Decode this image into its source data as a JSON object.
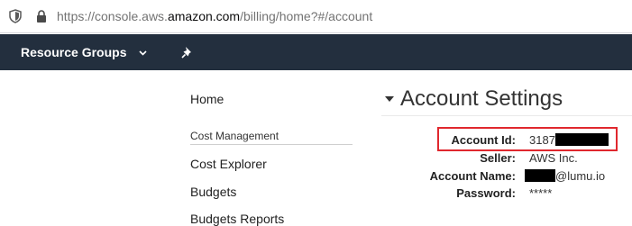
{
  "browser": {
    "url_prefix": "https://console.aws.",
    "url_domain": "amazon.com",
    "url_suffix": "/billing/home?#/account"
  },
  "aws_nav": {
    "resource_groups_label": "Resource Groups",
    "colors": {
      "nav_bg": "#232f3e",
      "nav_text": "#ffffff"
    }
  },
  "sidebar": {
    "home_label": "Home",
    "cost_management_section": "Cost Management",
    "items": [
      {
        "label": "Cost Explorer"
      },
      {
        "label": "Budgets"
      },
      {
        "label": "Budgets Reports"
      }
    ]
  },
  "account_settings": {
    "title": "Account Settings",
    "account_id_label": "Account Id:",
    "account_id_value_visible": "3187",
    "seller_label": "Seller:",
    "seller_value": "AWS Inc.",
    "account_name_label": "Account Name:",
    "account_name_suffix": "@lumu.io",
    "password_label": "Password:",
    "password_value": "*****",
    "highlight_color": "#e0282e"
  }
}
